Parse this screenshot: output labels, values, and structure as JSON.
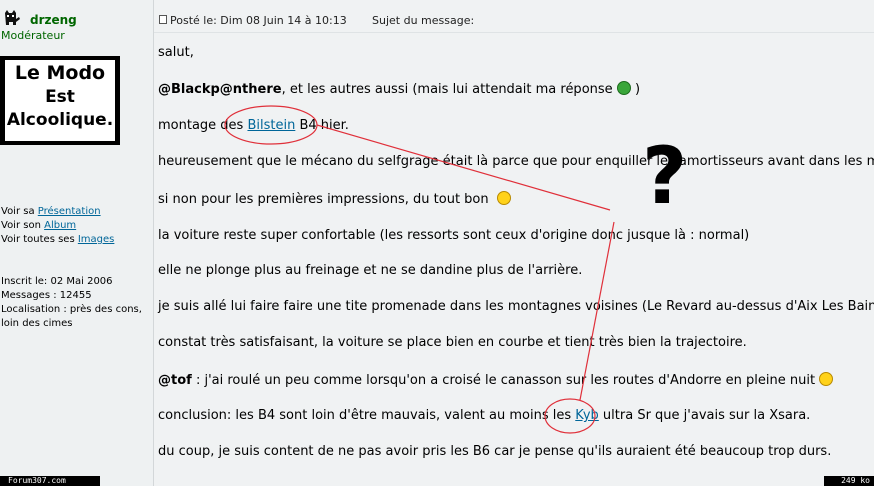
{
  "user": {
    "name": "drzeng",
    "rank": "Modérateur",
    "avatar_lines": [
      "Le Modo",
      "Est",
      "Alcoolique."
    ],
    "links": {
      "presentation_prefix": "Voir sa ",
      "presentation": "Présentation",
      "album_prefix": "Voir son ",
      "album": "Album",
      "images_prefix": "Voir toutes ses ",
      "images": "Images"
    },
    "profile": {
      "joined": "Inscrit le: 02 Mai 2006",
      "messages": "Messages : 12455",
      "location": "Localisation : près des cons, loin des cimes"
    }
  },
  "post": {
    "posted": "Posté le: Dim 08 Juin 14 à 10:13",
    "subject_label": "Sujet du message:",
    "line1": "salut,",
    "line2_mention": "@Blackp@nthere",
    "line2_rest": ", et les autres aussi (mais lui attendait ma réponse ",
    "line2_end": ")",
    "line3_a": "montage des ",
    "line3_link": "Bilstein",
    "line3_b": " B4 hier.",
    "line4": "heureusement que le mécano du selfgrage était là parce que pour enquiller les amortisseurs avant dans les moyeux",
    "line5": "si non pour les premières impressions, du tout bon",
    "line6": "la voiture reste super confortable (les ressorts sont ceux d'origine donc jusque là : normal)",
    "line7": "elle ne plonge plus au freinage et ne se dandine plus de l'arrière.",
    "line8": "je suis allé lui faire faire une tite promenade dans les montagnes voisines (Le Revard au-dessus d'Aix Les Bains p",
    "line9": "constat très satisfaisant, la voiture se place bien en courbe et tient très bien la trajectoire.",
    "line10_mention": "@tof",
    "line10_rest": " : j'ai roulé un peu comme lorsqu'on a croisé le canasson sur les routes d'Andorre en pleine nuit ",
    "line11_a": "conclusion: les B4 sont loin d'être mauvais, valent au moins les ",
    "line11_link": "Kyb",
    "line11_b": " ultra Sr que j'avais sur la Xsara.",
    "line12": "du coup, je suis content de ne pas avoir pris les B6 car je pense qu'ils auraient été beaucoup trop durs."
  },
  "annotation": {
    "question_mark": "?",
    "color": "#e0303a"
  },
  "footer": {
    "site": "Forum307.com",
    "size": "249 ko"
  }
}
